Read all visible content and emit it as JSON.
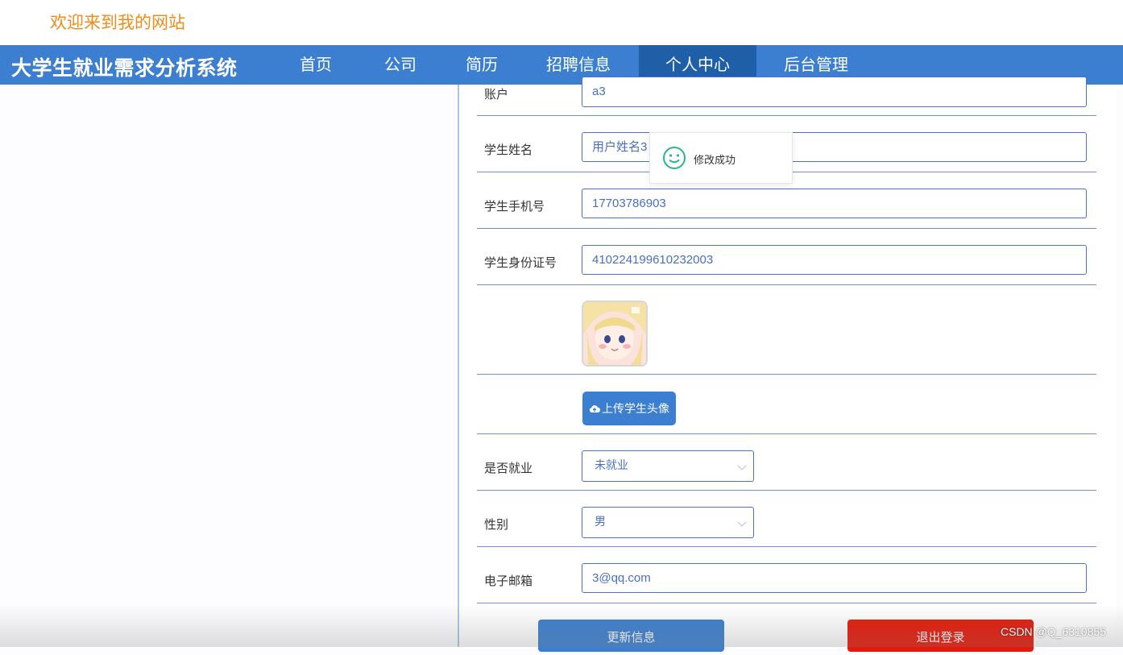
{
  "welcome": "欢迎来到我的网站",
  "site_title": "大学生就业需求分析系统",
  "nav": {
    "items": [
      {
        "label": "首页"
      },
      {
        "label": "公司"
      },
      {
        "label": "简历"
      },
      {
        "label": "招聘信息"
      },
      {
        "label": "个人中心"
      },
      {
        "label": "后台管理"
      }
    ],
    "active": "个人中心"
  },
  "form": {
    "account": {
      "label": "账户",
      "value": "a3"
    },
    "name": {
      "label": "学生姓名",
      "value": "用户姓名3"
    },
    "phone": {
      "label": "学生手机号",
      "value": "17703786903"
    },
    "id_card": {
      "label": "学生身份证号",
      "value": "410224199610232003"
    },
    "upload_button": "上传学生头像",
    "employed": {
      "label": "是否就业",
      "value": "未就业"
    },
    "gender": {
      "label": "性别",
      "value": "男"
    },
    "email": {
      "label": "电子邮箱",
      "value": "3@qq.com"
    },
    "update_button": "更新信息",
    "logout_button": "退出登录"
  },
  "toast": {
    "message": "修改成功"
  },
  "watermark": "CSDN @Q_6310855",
  "colors": {
    "nav": "#3c7fd0",
    "nav_active": "#1e5fa8",
    "welcome": "#f08c1a",
    "logout": "#e51a0a"
  }
}
